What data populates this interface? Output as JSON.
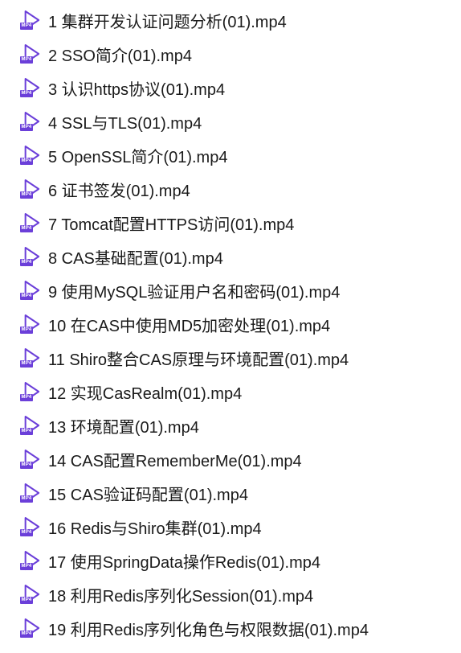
{
  "icon_badge": "MP4",
  "files": [
    {
      "name": "1 集群开发认证问题分析(01).mp4"
    },
    {
      "name": "2 SSO简介(01).mp4"
    },
    {
      "name": "3 认识https协议(01).mp4"
    },
    {
      "name": "4 SSL与TLS(01).mp4"
    },
    {
      "name": "5 OpenSSL简介(01).mp4"
    },
    {
      "name": "6 证书签发(01).mp4"
    },
    {
      "name": "7 Tomcat配置HTTPS访问(01).mp4"
    },
    {
      "name": "8 CAS基础配置(01).mp4"
    },
    {
      "name": "9 使用MySQL验证用户名和密码(01).mp4"
    },
    {
      "name": "10 在CAS中使用MD5加密处理(01).mp4"
    },
    {
      "name": "11 Shiro整合CAS原理与环境配置(01).mp4"
    },
    {
      "name": "12 实现CasRealm(01).mp4"
    },
    {
      "name": "13 环境配置(01).mp4"
    },
    {
      "name": "14 CAS配置RememberMe(01).mp4"
    },
    {
      "name": "15 CAS验证码配置(01).mp4"
    },
    {
      "name": "16 Redis与Shiro集群(01).mp4"
    },
    {
      "name": "17 使用SpringData操作Redis(01).mp4"
    },
    {
      "name": "18 利用Redis序列化Session(01).mp4"
    },
    {
      "name": "19 利用Redis序列化角色与权限数据(01).mp4"
    }
  ]
}
